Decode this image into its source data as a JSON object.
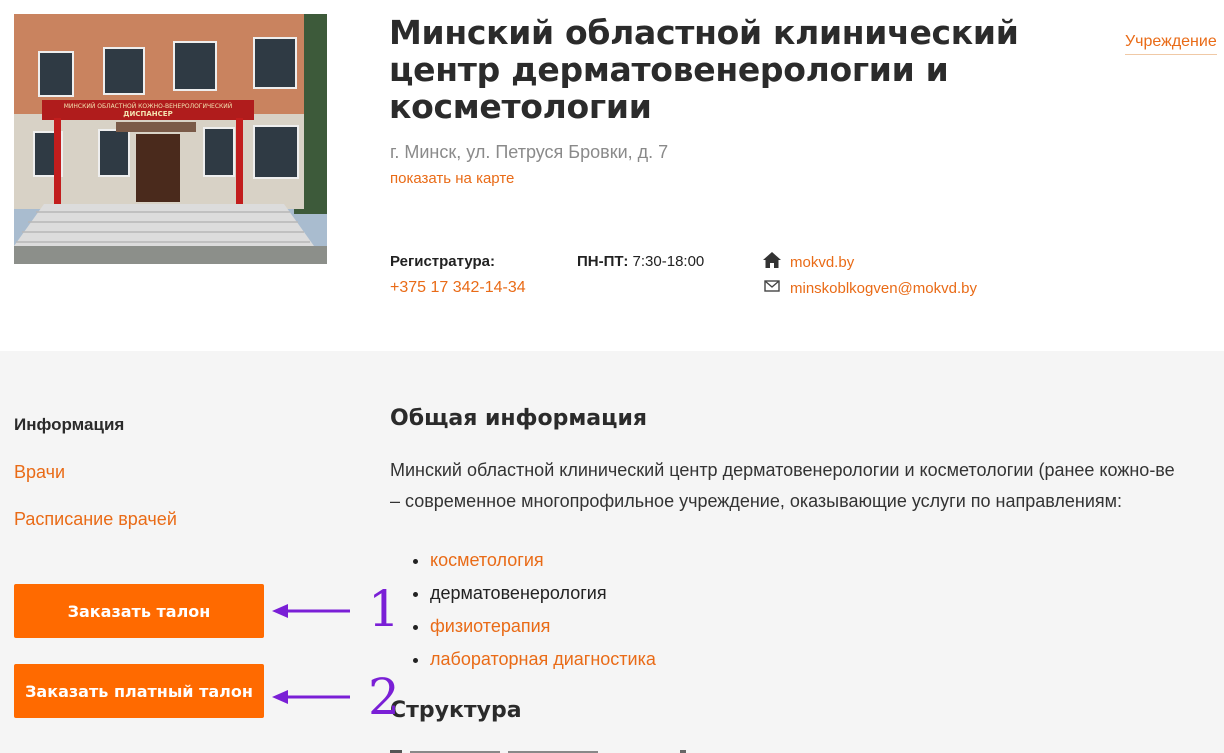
{
  "header": {
    "title": "Минский областной клинический центр дерматовенерологии и косметологии",
    "address": "г. Минск, ул. Петруся Бровки, д. 7",
    "map_link": "показать на карте",
    "category": "Учреждение",
    "building_sign": [
      "МИНСКИЙ ОБЛАСТНОЙ КОЖНО-ВЕНЕРОЛОГИЧЕСКИЙ",
      "ДИСПАНСЕР"
    ],
    "registry": {
      "label": "Регистратура:",
      "phone": "+375 17 342-14-34"
    },
    "hours": {
      "days": "ПН-ПТ:",
      "time": "7:30-18:00"
    },
    "website": "mokvd.by",
    "email": "minskoblkogven@mokvd.by"
  },
  "sidebar": {
    "info": "Информация",
    "doctors": "Врачи",
    "schedule": "Расписание врачей",
    "button_ticket": "Заказать талон",
    "button_paid_ticket": "Заказать платный талон"
  },
  "content": {
    "general_heading": "Общая информация",
    "paragraph_line1": "Минский областной клинический центр дерматовенерологии и косметологии (ранее кожно-ве",
    "paragraph_line2": "– современное многопрофильное учреждение, оказывающие услуги по направлениям:",
    "services": [
      {
        "label": "косметология",
        "link": true
      },
      {
        "label": "дерматовенерология",
        "link": false
      },
      {
        "label": "физиотерапия",
        "link": true
      },
      {
        "label": "лабораторная диагностика",
        "link": true
      }
    ],
    "structure_heading": "Структура"
  },
  "annotations": {
    "marker1": "1",
    "marker2": "2",
    "arrow_color": "#7a1fd6"
  },
  "colors": {
    "accent": "#e96b17",
    "button": "#ff6a00",
    "grey_bg": "#f5f5f5"
  }
}
